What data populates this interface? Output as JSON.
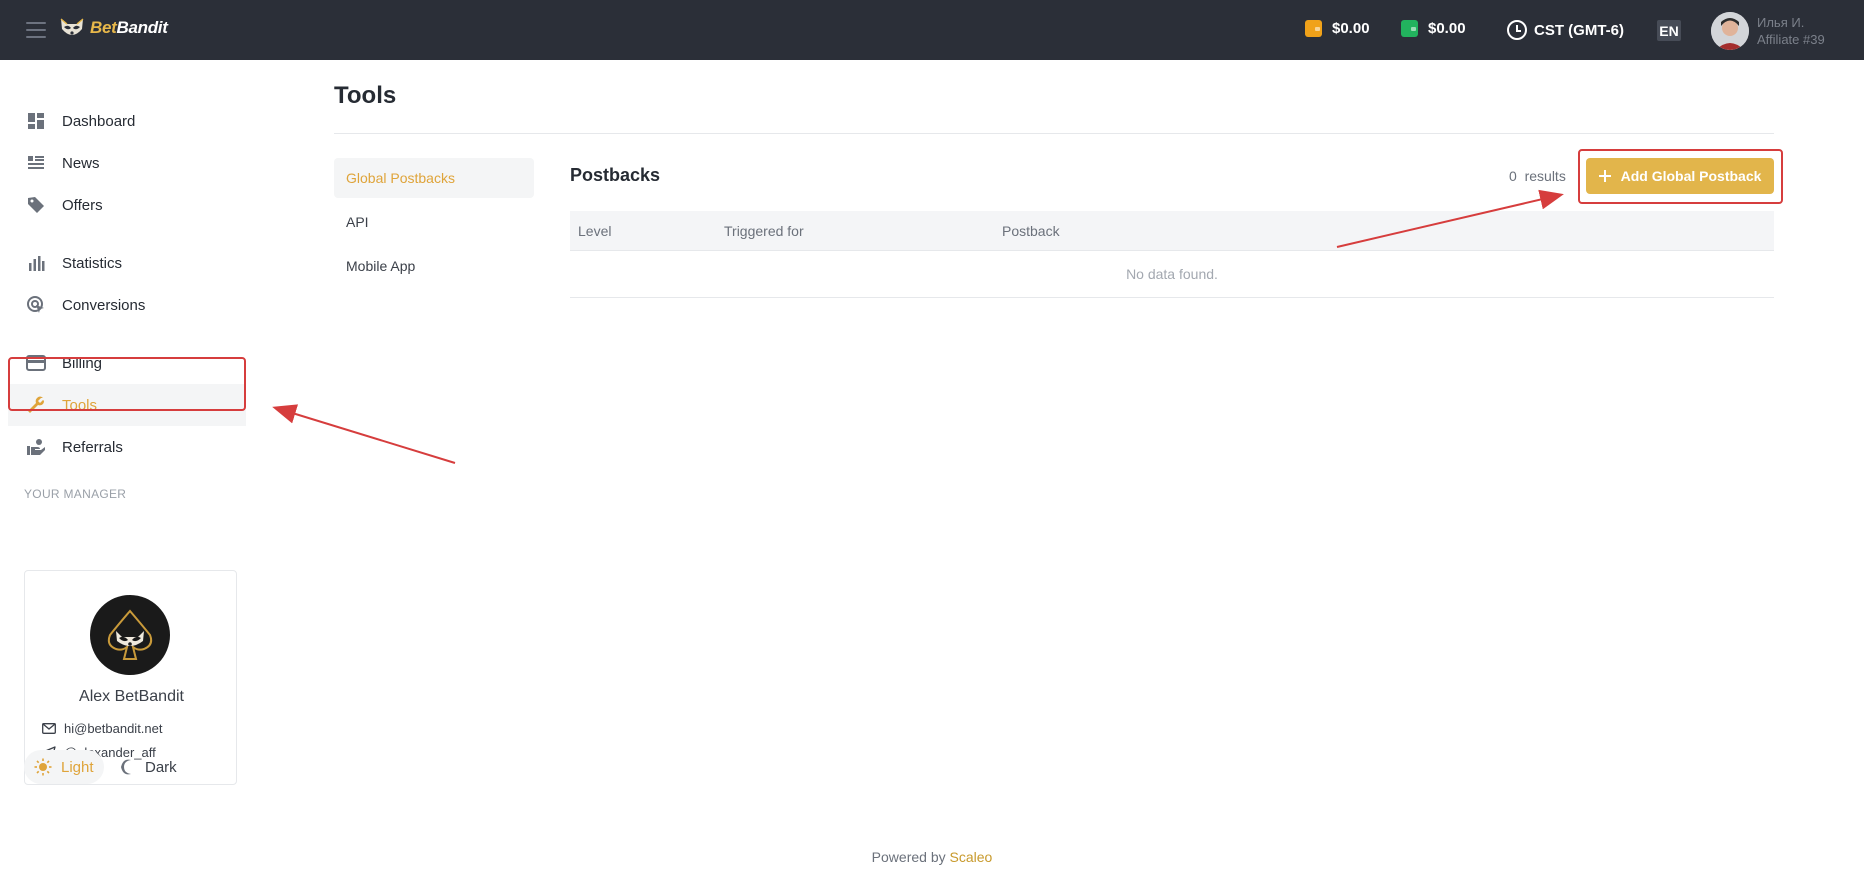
{
  "header": {
    "logo_text_1": "Bet",
    "logo_text_2": "Bandit",
    "balance_1": "$0.00",
    "balance_2": "$0.00",
    "timezone": "CST (GMT-6)",
    "language": "EN",
    "user_name": "Илья И.",
    "user_sub": "Affiliate #39"
  },
  "sidebar": {
    "items": [
      {
        "label": "Dashboard",
        "icon": "dashboard-icon"
      },
      {
        "label": "News",
        "icon": "news-icon"
      },
      {
        "label": "Offers",
        "icon": "tag-icon"
      },
      {
        "label": "Statistics",
        "icon": "bar-chart-icon"
      },
      {
        "label": "Conversions",
        "icon": "target-cursor-icon"
      },
      {
        "label": "Billing",
        "icon": "credit-card-icon"
      },
      {
        "label": "Tools",
        "icon": "wrench-icon",
        "active": true
      },
      {
        "label": "Referrals",
        "icon": "referrals-icon"
      }
    ],
    "manager_label": "YOUR MANAGER",
    "manager": {
      "name": "Alex BetBandit",
      "email": "hi@betbandit.net",
      "telegram": "@alexander_aff"
    },
    "theme_light": "Light",
    "theme_dark": "Dark"
  },
  "main": {
    "title": "Tools",
    "subnav": [
      "Global Postbacks",
      "API",
      "Mobile App"
    ],
    "section_title": "Postbacks",
    "results_count": "0",
    "results_label": "results",
    "add_button": "Add Global Postback",
    "columns": [
      "Level",
      "Triggered for",
      "Postback"
    ],
    "empty_text": "No data found."
  },
  "footer": {
    "powered_by": "Powered by",
    "brand": "Scaleo"
  },
  "colors": {
    "accent": "#e2b54b",
    "topbar": "#2b2f38",
    "highlight": "#d63d3d",
    "wallet_orange": "#f0a21a",
    "wallet_green": "#22b35e"
  }
}
